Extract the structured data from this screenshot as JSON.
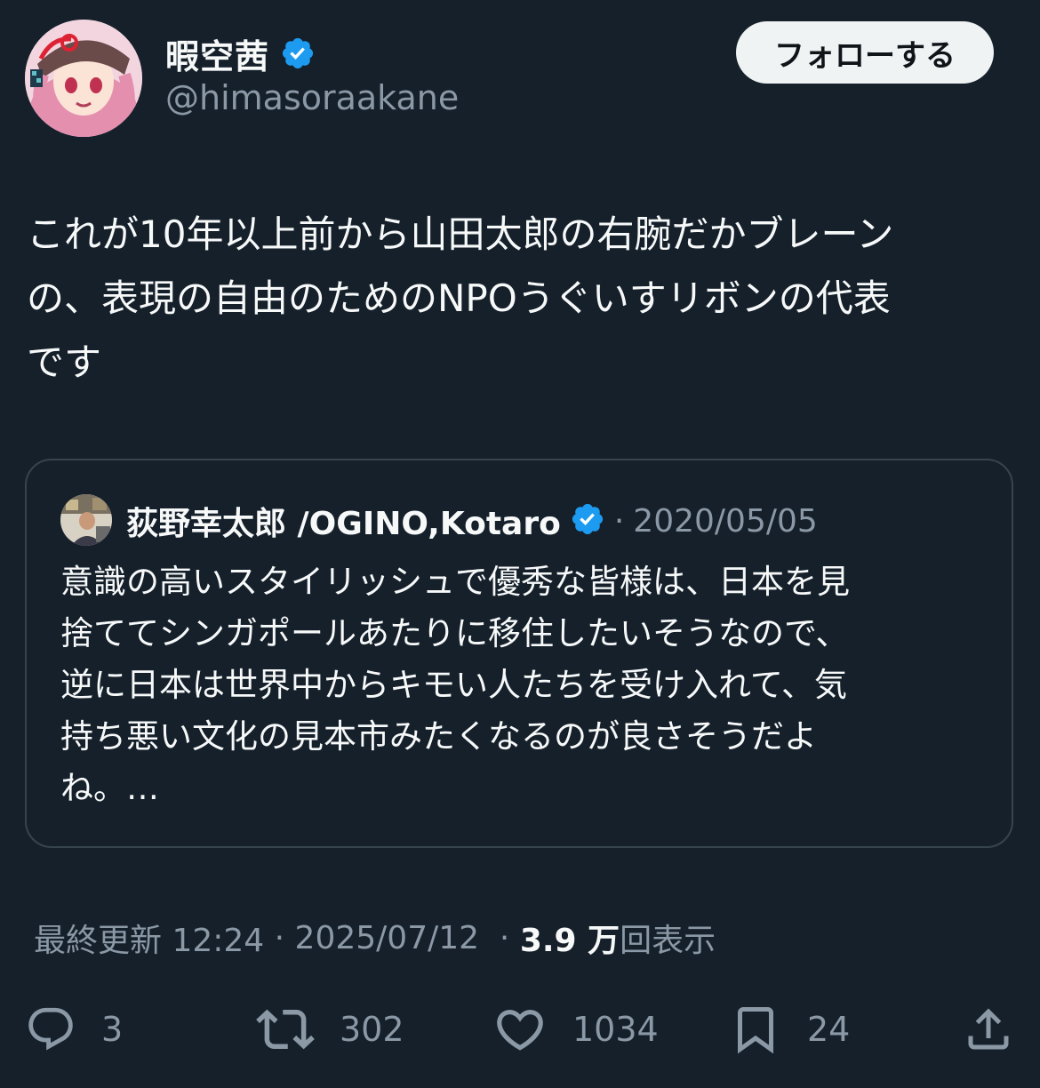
{
  "author": {
    "display_name": "暇空茜",
    "handle": "@himasoraakane",
    "verified": true
  },
  "follow_button": {
    "label": "フォローする"
  },
  "tweet": {
    "text": "これが10年以上前から山田太郎の右腕だかブレーン\nの、表現の自由のためのNPOうぐいすリボンの代表\nです"
  },
  "quote": {
    "author_name": "荻野幸太郎 /OGINO,Kotaro",
    "verified": true,
    "separator": "·",
    "date": "2020/05/05",
    "text": "意識の高いスタイリッシュで優秀な皆様は、日本を見\n捨ててシンガポールあたりに移住したいそうなので、\n逆に日本は世界中からキモい人たちを受け入れて、気\n持ち悪い文化の見本市みたくなるのが良さそうだよ\nね。…"
  },
  "meta": {
    "updated_label": "最終更新 12:24",
    "sep1": " · ",
    "date": "2025/07/12",
    "sep2": "  · ",
    "views_count": "3.9 万",
    "views_label": "回表示"
  },
  "actions": {
    "reply_count": "3",
    "retweet_count": "302",
    "like_count": "1034",
    "bookmark_count": "24"
  },
  "colors": {
    "background": "#15202b",
    "text_primary": "#f7f9f9",
    "text_secondary": "#8b98a5",
    "verified_blue": "#1d9bf0",
    "border": "#38444d",
    "follow_button_bg": "#eff3f4"
  }
}
